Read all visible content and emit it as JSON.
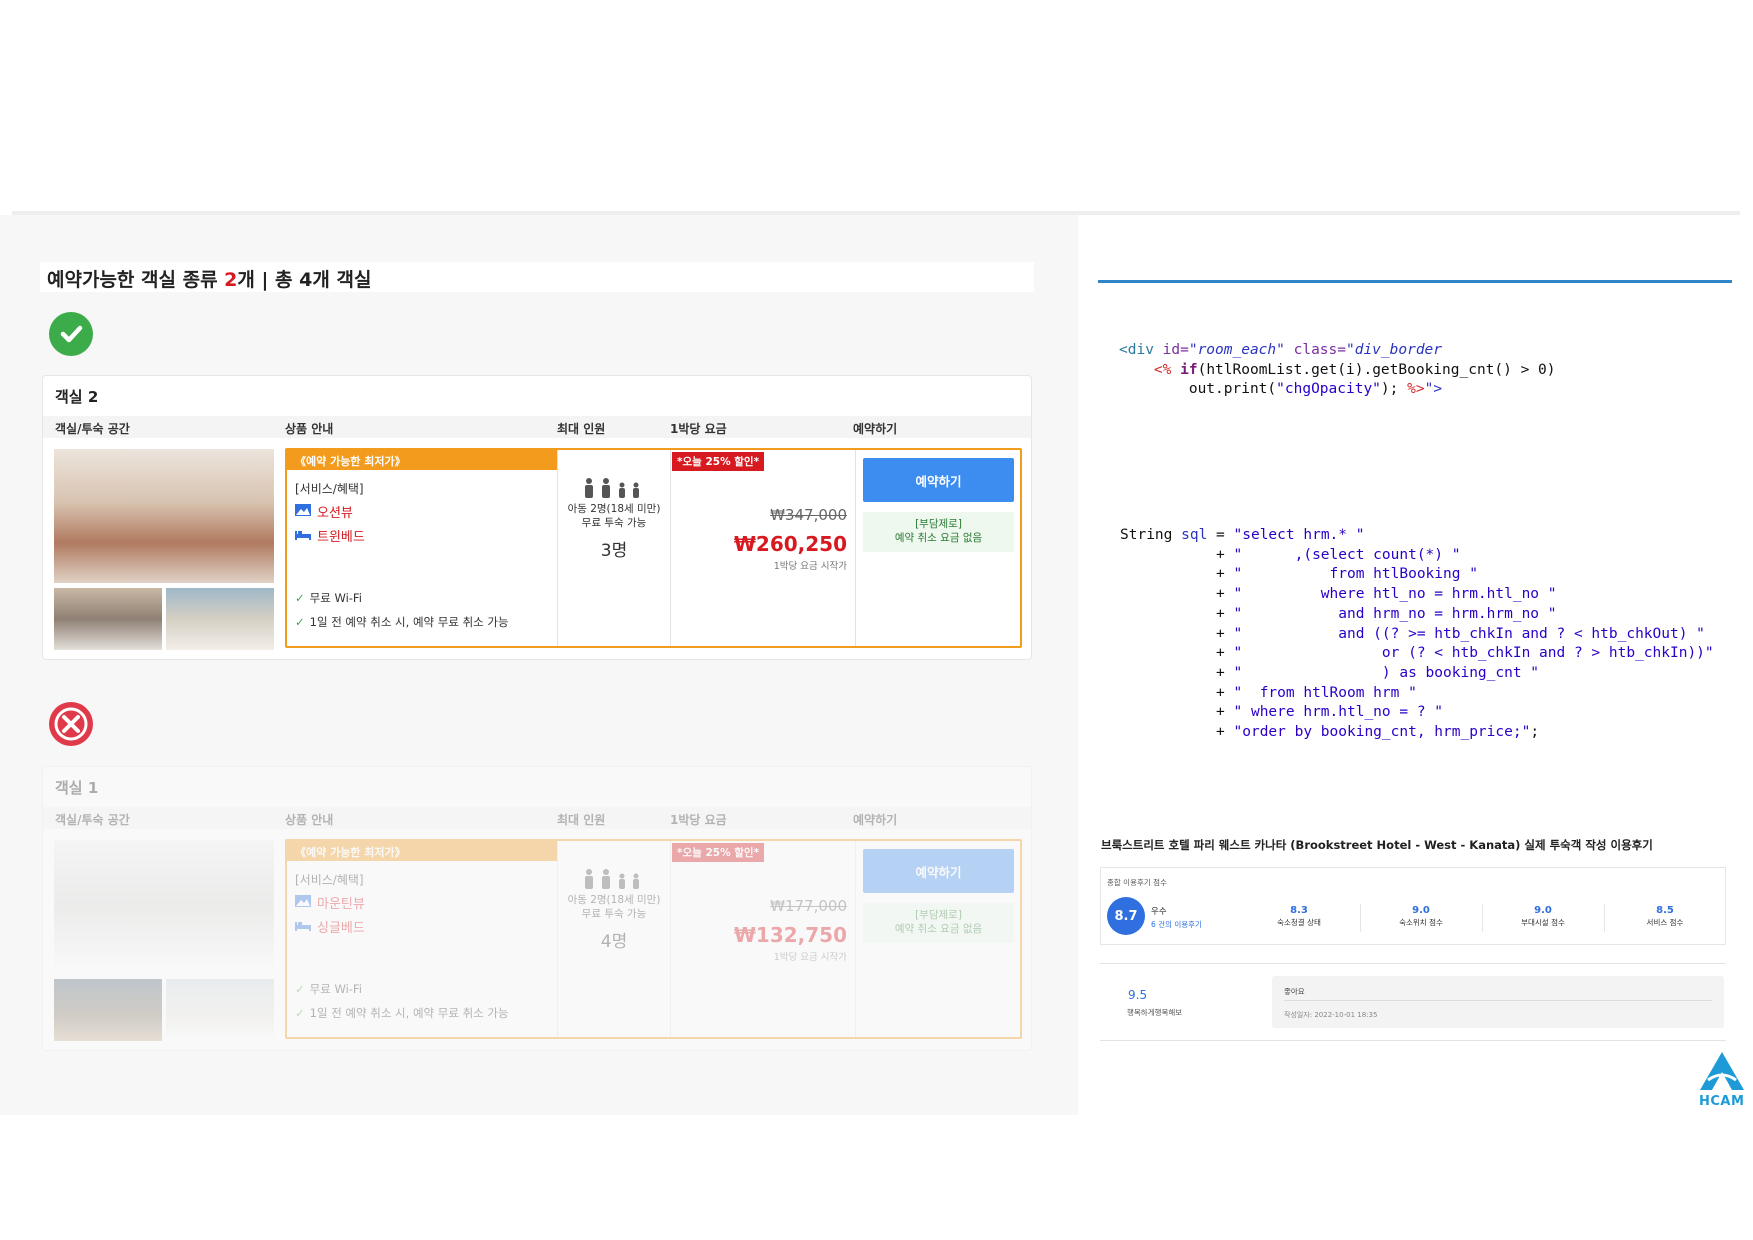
{
  "colors": {
    "accent_orange": "#f29b1d",
    "price_red": "#d71920",
    "button_blue": "#3d8cf0",
    "ok_green": "#3cab49",
    "error_red": "#e03a4a",
    "code_rule_blue": "#2e86c8"
  },
  "heading": {
    "prefix": "예약가능한 객실 종류 ",
    "types_count": "2",
    "suffix": "개 | 총 4개 객실"
  },
  "status": {
    "available_icon": "check-circle-icon",
    "unavailable_icon": "x-circle-icon"
  },
  "columns": {
    "room_space": "객실/투숙 공간",
    "product_info": "상품 안내",
    "max_guests": "최대 인원",
    "price_per_night": "1박당 요금",
    "reserve": "예약하기"
  },
  "rooms": [
    {
      "title": "객실 2",
      "deal_tag": "《예약 가능한 최저가》",
      "services_label": "[서비스/혜택]",
      "services": [
        {
          "icon": "view-icon",
          "label": "오션뷰"
        },
        {
          "icon": "bed-icon",
          "label": "트윈베드"
        }
      ],
      "benefits": [
        "무료 Wi-Fi",
        "1일 전 예약 취소 시, 예약 무료 취소 가능"
      ],
      "occupancy_note_1": "아동 2명(18세 미만)",
      "occupancy_note_2": "무료 투숙 가능",
      "occupancy": "3명",
      "discount_badge": "*오늘 25% 할인*",
      "original_price": "₩347,000",
      "price": "₩260,250",
      "price_note": "1박당 요금 시작가",
      "book_label": "예약하기",
      "free_cancel_title": "[부담제로]",
      "free_cancel_text": "예약 취소 요금 없음"
    },
    {
      "title": "객실 1",
      "deal_tag": "《예약 가능한 최저가》",
      "services_label": "[서비스/혜택]",
      "services": [
        {
          "icon": "view-icon",
          "label": "마운틴뷰"
        },
        {
          "icon": "bed-icon",
          "label": "싱글베드"
        }
      ],
      "benefits": [
        "무료 Wi-Fi",
        "1일 전 예약 취소 시, 예약 무료 취소 가능"
      ],
      "occupancy_note_1": "아동 2명(18세 미만)",
      "occupancy_note_2": "무료 투숙 가능",
      "occupancy": "4명",
      "discount_badge": "*오늘 25% 할인*",
      "original_price": "₩177,000",
      "price": "₩132,750",
      "price_note": "1박당 요금 시작가",
      "book_label": "예약하기",
      "free_cancel_title": "[부담제로]",
      "free_cancel_text": "예약 취소 요금 없음"
    }
  ],
  "code_jsp": {
    "l1_tag": "<div",
    "l1_attr1": " id=",
    "l1_val1": "\"room_each\"",
    "l1_attr2": " class=",
    "l1_val2": "\"div_border",
    "l2_indent": "    ",
    "l2_open": "<%",
    "l2_kw": " if",
    "l2_rest": "(htlRoomList.get(i).getBooking_cnt() > 0)",
    "l3_indent": "        ",
    "l3_code": "out.print(",
    "l3_str": "\"chgOpacity\"",
    "l3_end": "); ",
    "l3_close": "%>",
    "l3_quote": "\">"
  },
  "code_sql": {
    "l1_type": "String ",
    "l1_var": "sql",
    "l1_eq": " = ",
    "l1_str": "\"select hrm.* \"",
    "lines": [
      {
        "op": "           + ",
        "str": "\"      ,(select count(*) \""
      },
      {
        "op": "           + ",
        "str": "\"          from htlBooking \""
      },
      {
        "op": "           + ",
        "str": "\"         where htl_no = hrm.htl_no \""
      },
      {
        "op": "           + ",
        "str": "\"           and hrm_no = hrm.hrm_no \""
      },
      {
        "op": "           + ",
        "str": "\"           and ((? >= htb_chkIn and ? < htb_chkOut) \""
      },
      {
        "op": "           + ",
        "str": "\"                or (? < htb_chkIn and ? > htb_chkIn))\""
      },
      {
        "op": "           + ",
        "str": "\"                ) as booking_cnt \""
      },
      {
        "op": "           + ",
        "str": "\"  from htlRoom hrm \""
      },
      {
        "op": "           + ",
        "str": "\" where hrm.htl_no = ? \""
      },
      {
        "op": "           + ",
        "str": "\"order by booking_cnt, hrm_price;\""
      }
    ],
    "end": ";"
  },
  "review": {
    "title": "브룩스트리트 호텔 파리 웨스트 카나타 (Brookstreet Hotel - West - Kanata) 실제 투숙객 작성 이용후기",
    "overall_label": "종합 이용후기 점수",
    "overall_score": "8.7",
    "grade": "우수",
    "review_count": "6 건의 이용후기",
    "metrics": [
      {
        "value": "8.3",
        "name": "숙소청결 상태"
      },
      {
        "value": "9.0",
        "name": "숙소위치 점수"
      },
      {
        "value": "9.0",
        "name": "부대시설 점수"
      },
      {
        "value": "8.5",
        "name": "서비스 점수"
      }
    ],
    "item": {
      "score": "9.5",
      "user": "행복하게행복해보",
      "text": "좋아요",
      "date": "작성일자: 2022-10-01 18:35"
    }
  },
  "logo_text": "HCAM"
}
